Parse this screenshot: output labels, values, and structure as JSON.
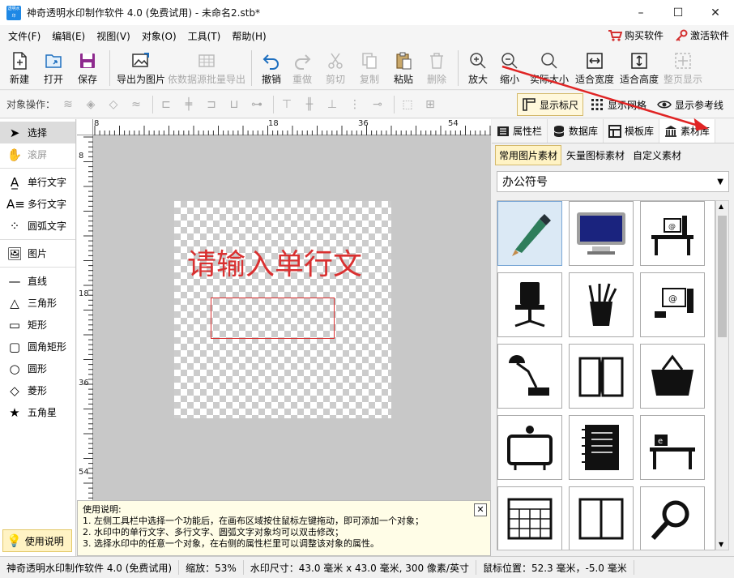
{
  "window": {
    "title": "神奇透明水印制作软件 4.0 (免费试用) - 未命名2.stb*",
    "app_icon_text": "透明水印",
    "minimize": "–",
    "maximize": "☐",
    "close": "✕"
  },
  "menu": {
    "items": [
      "文件(F)",
      "编辑(E)",
      "视图(V)",
      "对象(O)",
      "工具(T)",
      "帮助(H)"
    ],
    "buy": "购买软件",
    "activate": "激活软件"
  },
  "toolbar": {
    "buttons": [
      "新建",
      "打开",
      "保存",
      "导出为图片",
      "依数据源批量导出",
      "撤销",
      "重做",
      "剪切",
      "复制",
      "粘贴",
      "删除",
      "放大",
      "缩小",
      "实际大小",
      "适合宽度",
      "适合高度",
      "整页显示"
    ]
  },
  "objbar": {
    "label": "对象操作：",
    "show_ruler": "显示标尺",
    "show_grid": "显示网格",
    "show_guides": "显示参考线"
  },
  "tools": [
    "选择",
    "滚屏",
    "单行文字",
    "多行文字",
    "圆弧文字",
    "图片",
    "直线",
    "三角形",
    "矩形",
    "圆角矩形",
    "圆形",
    "菱形",
    "五角星"
  ],
  "help_button": "使用说明",
  "ruler": {
    "h_labels": [
      "8",
      "18",
      "36",
      "54"
    ],
    "v_labels": [
      "8",
      "18",
      "36",
      "54"
    ]
  },
  "canvas": {
    "watermark_text": "请输入单行文"
  },
  "help_box": {
    "title": "使用说明:",
    "lines": [
      "1. 左侧工具栏中选择一个功能后，在画布区域按住鼠标左键拖动，即可添加一个对象；",
      "2. 水印中的单行文字、多行文字、圆弧文字对象均可以双击修改；",
      "3. 选择水印中的任意一个对象，在右侧的属性栏里可以调整该对象的属性。"
    ],
    "close": "✕"
  },
  "right_panel": {
    "tabs": [
      "属性栏",
      "数据库",
      "模板库",
      "素材库"
    ],
    "subtabs": [
      "常用图片素材",
      "矢量图标素材",
      "自定义素材"
    ],
    "category": "办公符号"
  },
  "status": {
    "app": "神奇透明水印制作软件 4.0 (免费试用)",
    "zoom": "缩放：53%",
    "size": "水印尺寸：43.0 毫米 x 43.0 毫米, 300 像素/英寸",
    "mouse": "鼠标位置：52.3 毫米，-5.0 毫米"
  },
  "colors": {
    "watermark": "#d93030",
    "accent": "#1e88e5"
  }
}
